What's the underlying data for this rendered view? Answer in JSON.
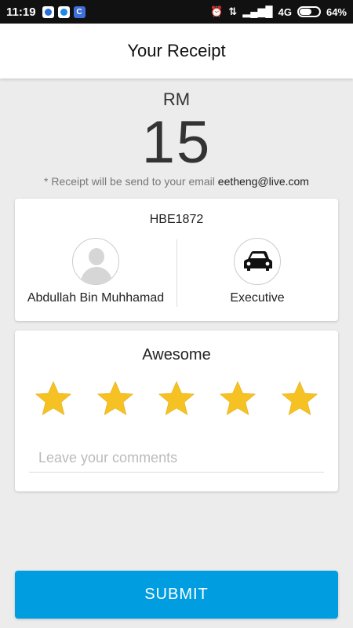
{
  "status_bar": {
    "time": "11:19",
    "network": "4G",
    "battery": "64%",
    "battery_level": 0.64
  },
  "header": {
    "title": "Your Receipt"
  },
  "receipt": {
    "currency": "RM",
    "amount": "15",
    "note_prefix": "* Receipt will be send to your email ",
    "email": "eetheng@live.com"
  },
  "driver": {
    "plate": "HBE1872",
    "name": "Abdullah Bin Muhhamad",
    "car_type": "Executive"
  },
  "rating": {
    "label": "Awesome",
    "stars": 5,
    "star_color": "#f5c123",
    "comment_placeholder": "Leave your comments",
    "comment_value": ""
  },
  "submit": {
    "label": "SUBMIT",
    "color": "#009de0"
  }
}
